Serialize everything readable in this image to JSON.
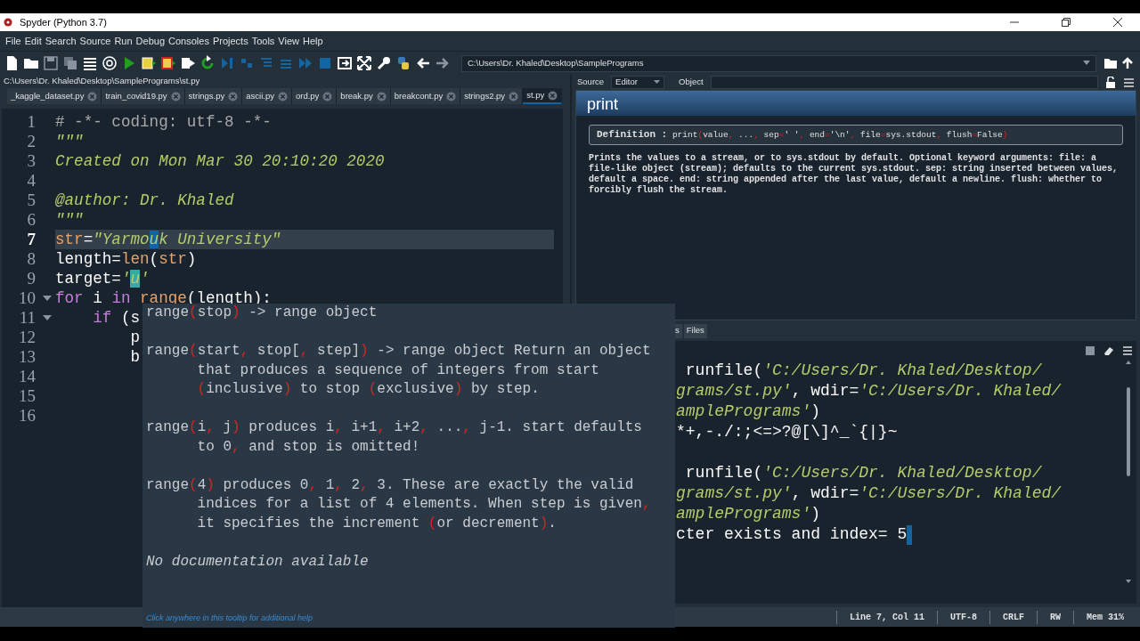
{
  "window": {
    "title": "Spyder (Python 3.7)"
  },
  "menu": [
    "File",
    "Edit",
    "Search",
    "Source",
    "Run",
    "Debug",
    "Consoles",
    "Projects",
    "Tools",
    "View",
    "Help"
  ],
  "working_directory": "C:\\Users\\Dr. Khaled\\Desktop\\SamplePrograms",
  "file_path": "C:\\Users\\Dr. Khaled\\Desktop\\SamplePrograms\\st.py",
  "editor_tabs": [
    {
      "label": "_kaggle_dataset.py",
      "selected": false
    },
    {
      "label": "train_covid19.py",
      "selected": false
    },
    {
      "label": "strings.py",
      "selected": false
    },
    {
      "label": "ascii.py",
      "selected": false
    },
    {
      "label": "ord.py",
      "selected": false
    },
    {
      "label": "break.py",
      "selected": false
    },
    {
      "label": "breakcont.py",
      "selected": false
    },
    {
      "label": "strings2.py",
      "selected": false
    },
    {
      "label": "st.py",
      "selected": true
    }
  ],
  "editor": {
    "lines": [
      {
        "number": "1",
        "current": false,
        "foldable": false,
        "tokens": [
          {
            "kind": "comment",
            "text": "# -*- coding: utf-8 -*-"
          }
        ]
      },
      {
        "number": "2",
        "current": false,
        "foldable": false,
        "tokens": [
          {
            "kind": "docstring",
            "text": "\"\"\""
          }
        ]
      },
      {
        "number": "3",
        "current": false,
        "foldable": false,
        "tokens": [
          {
            "kind": "docstring",
            "text": "Created on Mon Mar 30 20:10:20 2020"
          }
        ]
      },
      {
        "number": "4",
        "current": false,
        "foldable": false
      },
      {
        "number": "5",
        "current": false,
        "foldable": false,
        "tokens": [
          {
            "kind": "docstring",
            "text": "@author: Dr. Khaled"
          }
        ]
      },
      {
        "number": "6",
        "current": false,
        "foldable": false,
        "tokens": [
          {
            "kind": "docstring",
            "text": "\"\"\""
          }
        ]
      },
      {
        "number": "7",
        "current": true,
        "foldable": false,
        "tokens": [
          {
            "kind": "builtin",
            "text": "str"
          },
          {
            "kind": "op",
            "text": "="
          },
          {
            "kind": "string",
            "text": "\"Yarmo"
          },
          {
            "kind": "cursor",
            "text": "u"
          },
          {
            "kind": "string",
            "text": "k University\""
          }
        ]
      },
      {
        "number": "8",
        "current": false,
        "foldable": false,
        "tokens": [
          {
            "kind": "name",
            "text": "length"
          },
          {
            "kind": "op",
            "text": "="
          },
          {
            "kind": "builtin",
            "text": "len"
          },
          {
            "kind": "op",
            "text": "("
          },
          {
            "kind": "builtin",
            "text": "str"
          },
          {
            "kind": "op",
            "text": ")"
          }
        ]
      },
      {
        "number": "9",
        "current": false,
        "foldable": false,
        "tokens": [
          {
            "kind": "name",
            "text": "target"
          },
          {
            "kind": "op",
            "text": "="
          },
          {
            "kind": "string",
            "text": "'"
          },
          {
            "kind": "match",
            "text": "u"
          },
          {
            "kind": "string",
            "text": "'"
          }
        ]
      },
      {
        "number": "10",
        "current": false,
        "foldable": true,
        "tokens": [
          {
            "kind": "keyword",
            "text": "for"
          },
          {
            "kind": "name",
            "text": " i "
          },
          {
            "kind": "keyword",
            "text": "in"
          },
          {
            "kind": "builtin",
            "text": " range"
          },
          {
            "kind": "op",
            "text": "("
          },
          {
            "kind": "name",
            "text": "length"
          },
          {
            "kind": "op",
            "text": "):"
          }
        ]
      },
      {
        "number": "11",
        "current": false,
        "foldable": true,
        "tokens": [
          {
            "kind": "keyword",
            "text": "    if"
          },
          {
            "kind": "name",
            "text": " (s"
          }
        ]
      },
      {
        "number": "12",
        "current": false,
        "foldable": false,
        "tokens": [
          {
            "kind": "name",
            "text": "        p"
          }
        ]
      },
      {
        "number": "13",
        "current": false,
        "foldable": false,
        "tokens": [
          {
            "kind": "name",
            "text": "        b"
          }
        ]
      },
      {
        "number": "14",
        "current": false,
        "foldable": false
      },
      {
        "number": "15",
        "current": false,
        "foldable": false
      },
      {
        "number": "16",
        "current": false,
        "foldable": false
      }
    ]
  },
  "help": {
    "source_label": "Source",
    "source_value": "Editor",
    "object_label": "Object",
    "title": "print",
    "definition_label": "Definition :",
    "definition": "print(value, ..., sep=' ', end='\\n', file=sys.stdout, flush=False)",
    "text": "Prints the values to a stream, or to sys.stdout by default. Optional keyword arguments: file: a file-like object (stream); defaults to the current sys.stdout. sep: string inserted between values, default a space. end: string appended after the last value, default a newline. flush: whether to forcibly flush the stream."
  },
  "console": {
    "tabs": [
      "s",
      "Files"
    ],
    "blocks": [
      {
        "lines": [
          {
            "tokens": [
              {
                "kind": "plain",
                "text": " runfile("
              },
              {
                "kind": "string",
                "text": "'C:/Users/Dr. Khaled/Desktop/"
              }
            ]
          },
          {
            "tokens": [
              {
                "kind": "string",
                "text": "grams/st.py'"
              },
              {
                "kind": "plain",
                "text": ", wdir="
              },
              {
                "kind": "string",
                "text": "'C:/Users/Dr. Khaled/"
              }
            ]
          },
          {
            "tokens": [
              {
                "kind": "string",
                "text": "amplePrograms'"
              },
              {
                "kind": "plain",
                "text": ")"
              }
            ]
          },
          {
            "tokens": [
              {
                "kind": "plain",
                "text": "*+,-./:;<=>?@[\\]^_`{|}~"
              }
            ]
          }
        ]
      },
      {
        "lines": [
          {
            "tokens": [
              {
                "kind": "plain",
                "text": " runfile("
              },
              {
                "kind": "string",
                "text": "'C:/Users/Dr. Khaled/Desktop/"
              }
            ]
          },
          {
            "tokens": [
              {
                "kind": "string",
                "text": "grams/st.py'"
              },
              {
                "kind": "plain",
                "text": ", wdir="
              },
              {
                "kind": "string",
                "text": "'C:/Users/Dr. Khaled/"
              }
            ]
          },
          {
            "tokens": [
              {
                "kind": "string",
                "text": "amplePrograms'"
              },
              {
                "kind": "plain",
                "text": ")"
              }
            ]
          },
          {
            "tokens": [
              {
                "kind": "plain",
                "text": "cter exists and index= 5"
              }
            ]
          }
        ]
      }
    ]
  },
  "tooltip": {
    "paragraphs": [
      {
        "kind": "signature",
        "lines": [
          "range(stop) -> range object"
        ]
      },
      {
        "kind": "doc",
        "lines": [
          "range(start, stop[, step]) -> range object Return an object",
          "that produces a sequence of integers from start",
          "(inclusive) to stop (exclusive) by step."
        ]
      },
      {
        "kind": "doc",
        "lines": [
          "range(i, j) produces i, i+1, i+2, ..., j-1. start defaults",
          "to 0, and stop is omitted!"
        ]
      },
      {
        "kind": "doc",
        "lines": [
          "range(4) produces 0, 1, 2, 3. These are exactly the valid",
          "indices for a list of 4 elements. When step is given,",
          "it specifies the increment (or decrement)."
        ]
      },
      {
        "kind": "note",
        "lines": [
          "No documentation available"
        ]
      }
    ],
    "footer": "Click anywhere in this tooltip for additional help"
  },
  "status_bar": [
    "Line 7, Col 11",
    "UTF-8",
    "CRLF",
    "RW",
    "Mem 31%"
  ]
}
